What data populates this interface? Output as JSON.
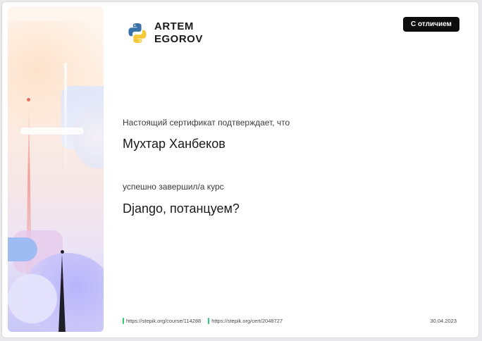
{
  "header": {
    "logo_line1": "ARTEM",
    "logo_line2": "EGOROV",
    "badge": "С отличием"
  },
  "certificate": {
    "intro": "Настоящий сертификат подтверждает, что",
    "recipient": "Мухтар Ханбеков",
    "completed_text": "успешно завершил/а  курс",
    "course_title": "Django, потанцуем?"
  },
  "footer": {
    "course_link": "https://stepik.org/course/114288",
    "cert_link": "https://stepik.org/cert/2048727",
    "date": "30.04.2023"
  },
  "colors": {
    "badge_bg": "#0d0d0d",
    "link_marker": "#2ecc71",
    "python_blue": "#3872a8",
    "python_yellow": "#f5c93a"
  },
  "icons": {
    "logo": "python-logo-icon"
  }
}
